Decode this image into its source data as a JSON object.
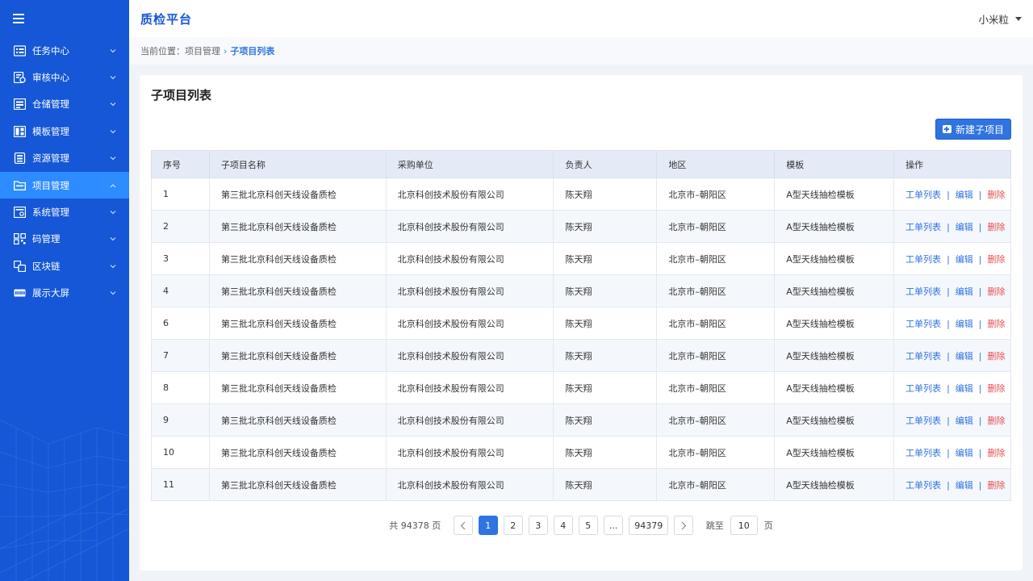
{
  "header": {
    "brand": "质检平台",
    "user": "小米粒"
  },
  "sidebar": {
    "items": [
      {
        "label": "任务中心",
        "icon": "list-icon"
      },
      {
        "label": "审核中心",
        "icon": "audit-icon"
      },
      {
        "label": "仓储管理",
        "icon": "warehouse-icon"
      },
      {
        "label": "模板管理",
        "icon": "template-icon"
      },
      {
        "label": "资源管理",
        "icon": "resource-icon"
      },
      {
        "label": "项目管理",
        "icon": "folder-icon",
        "active": true
      },
      {
        "label": "系统管理",
        "icon": "system-icon"
      },
      {
        "label": "码管理",
        "icon": "qr-code-icon"
      },
      {
        "label": "区块链",
        "icon": "blockchain-icon"
      },
      {
        "label": "展示大屏",
        "icon": "display-icon"
      }
    ]
  },
  "breadcrumb": {
    "prefix": "当前位置：",
    "parent": "项目管理",
    "current": "子项目列表"
  },
  "page": {
    "title": "子项目列表",
    "new_button": "新建子项目"
  },
  "table": {
    "columns": [
      "序号",
      "子项目名称",
      "采购单位",
      "负责人",
      "地区",
      "模板",
      "操作"
    ],
    "actions": {
      "list": "工单列表",
      "edit": "编辑",
      "delete": "删除",
      "sep": "|"
    },
    "rows": [
      [
        "1",
        "第三批北京科创天线设备质检",
        "北京科创技术股份有限公司",
        "陈天翔",
        "北京市–朝阳区",
        "A型天线抽检模板"
      ],
      [
        "2",
        "第三批北京科创天线设备质检",
        "北京科创技术股份有限公司",
        "陈天翔",
        "北京市–朝阳区",
        "A型天线抽检模板"
      ],
      [
        "3",
        "第三批北京科创天线设备质检",
        "北京科创技术股份有限公司",
        "陈天翔",
        "北京市–朝阳区",
        "A型天线抽检模板"
      ],
      [
        "4",
        "第三批北京科创天线设备质检",
        "北京科创技术股份有限公司",
        "陈天翔",
        "北京市–朝阳区",
        "A型天线抽检模板"
      ],
      [
        "6",
        "第三批北京科创天线设备质检",
        "北京科创技术股份有限公司",
        "陈天翔",
        "北京市–朝阳区",
        "A型天线抽检模板"
      ],
      [
        "7",
        "第三批北京科创天线设备质检",
        "北京科创技术股份有限公司",
        "陈天翔",
        "北京市–朝阳区",
        "A型天线抽检模板"
      ],
      [
        "8",
        "第三批北京科创天线设备质检",
        "北京科创技术股份有限公司",
        "陈天翔",
        "北京市–朝阳区",
        "A型天线抽检模板"
      ],
      [
        "9",
        "第三批北京科创天线设备质检",
        "北京科创技术股份有限公司",
        "陈天翔",
        "北京市–朝阳区",
        "A型天线抽检模板"
      ],
      [
        "10",
        "第三批北京科创天线设备质检",
        "北京科创技术股份有限公司",
        "陈天翔",
        "北京市–朝阳区",
        "A型天线抽检模板"
      ],
      [
        "11",
        "第三批北京科创天线设备质检",
        "北京科创技术股份有限公司",
        "陈天翔",
        "北京市–朝阳区",
        "A型天线抽检模板"
      ]
    ]
  },
  "pagination": {
    "total": "共 94378 页",
    "pages": [
      "1",
      "2",
      "3",
      "4",
      "5",
      "...",
      "94379"
    ],
    "active_page": "1",
    "jump_label": "跳至",
    "jump_value": "10",
    "jump_suffix": "页"
  },
  "colors": {
    "sidebar": "#1557d6",
    "active": "#2d8cff",
    "accent": "#2f74e0",
    "danger": "#e64f4f"
  }
}
